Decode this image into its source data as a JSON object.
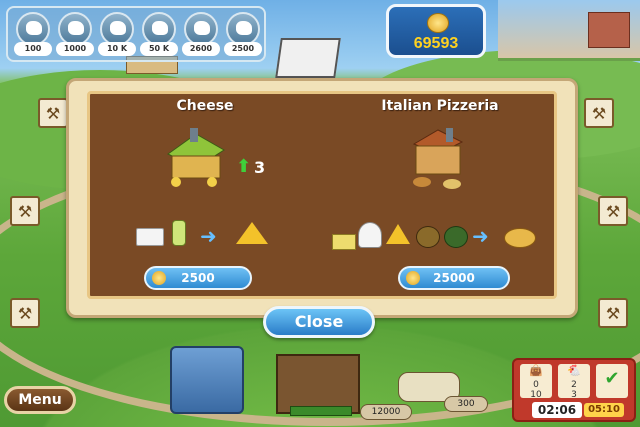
{
  "top_slots": [
    {
      "value": "100",
      "icon": "hen-icon"
    },
    {
      "value": "1000",
      "icon": "cow-icon"
    },
    {
      "value": "10 K",
      "icon": "pig-icon"
    },
    {
      "value": "50 K",
      "icon": "goat-icon"
    },
    {
      "value": "2600",
      "icon": "horse-icon"
    },
    {
      "value": "2500",
      "icon": "sheep-icon"
    }
  ],
  "money": {
    "amount": "69593"
  },
  "dialog": {
    "left": {
      "title": "Cheese",
      "upgrade": "3",
      "price": "2500"
    },
    "right": {
      "title": "Italian Pizzeria",
      "price": "25000"
    },
    "close_label": "Close"
  },
  "menu_label": "Menu",
  "hud": {
    "goal_1": "0",
    "goal_1_of": "10",
    "goal_2": "2",
    "goal_2_of": "3",
    "truck_cost": "12000",
    "plane_cost": "300",
    "time": "02:06",
    "gold_time": "05:10"
  },
  "colors": {
    "panel_bg": "#f1e2b9",
    "inner_bg": "#7a4a25",
    "button_blue": "#2f8bd2",
    "money_text": "#ffd21f"
  }
}
